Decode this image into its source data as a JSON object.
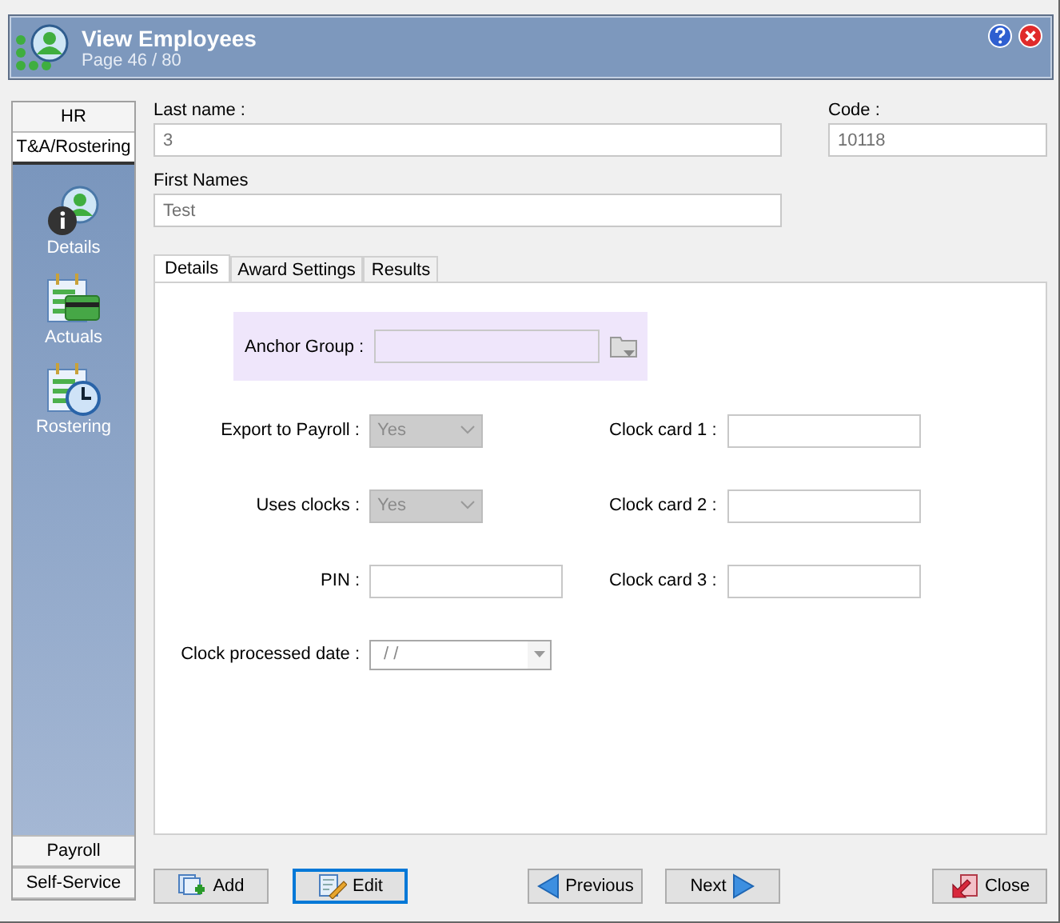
{
  "window": {
    "title": "View Employees",
    "subtitle": "Page 46 / 80"
  },
  "sidebar": {
    "top_tabs": [
      {
        "label": "HR",
        "selected": false
      },
      {
        "label": "T&A/Rostering",
        "selected": true
      }
    ],
    "items": [
      {
        "label": "Details",
        "kind": "details"
      },
      {
        "label": "Actuals",
        "kind": "actuals"
      },
      {
        "label": "Rostering",
        "kind": "rostering"
      }
    ],
    "bottom_tabs": [
      {
        "label": "Payroll",
        "selected": false
      },
      {
        "label": "Self-Service",
        "selected": false
      }
    ]
  },
  "last_name": {
    "label": "Last name :",
    "value": "3"
  },
  "code": {
    "label": "Code :",
    "value": "10118"
  },
  "first_names": {
    "label": "First Names",
    "value": "Test"
  },
  "tabs": [
    {
      "label": "Details",
      "selected": true
    },
    {
      "label": "Award Settings",
      "selected": false
    },
    {
      "label": "Results",
      "selected": false
    }
  ],
  "anchor_group": {
    "label": "Anchor Group :"
  },
  "rows": [
    {
      "label": "Export to Payroll :",
      "kind": "select",
      "value": "Yes",
      "side_label": "Clock card 1 :"
    },
    {
      "label": "Uses clocks :",
      "kind": "select",
      "value": "Yes",
      "side_label": "Clock card 2 :"
    },
    {
      "label": "PIN :",
      "kind": "text",
      "side_label": "Clock card 3 :"
    },
    {
      "label": "Clock processed date :",
      "kind": "date",
      "value": "/  /"
    }
  ],
  "buttons": [
    {
      "label": "Add",
      "kind": "add",
      "focused": false
    },
    {
      "label": "Edit",
      "kind": "edit",
      "focused": true
    },
    {
      "label": "Previous",
      "kind": "previous",
      "focused": false
    },
    {
      "label": "Next",
      "kind": "next",
      "focused": false
    },
    {
      "label": "Close",
      "kind": "close",
      "focused": false
    }
  ]
}
